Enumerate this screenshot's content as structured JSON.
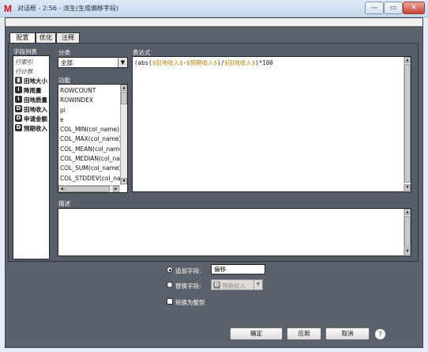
{
  "window": {
    "app_icon": "M",
    "title": "对话框 - 2:56 - 派生(生成偏移字段)",
    "minimize_glyph": "—",
    "maximize_glyph": "▭",
    "close_glyph": "✕"
  },
  "tabs": [
    {
      "label": "配置",
      "selected": true
    },
    {
      "label": "优化",
      "selected": false
    },
    {
      "label": "注释",
      "selected": false
    }
  ],
  "field_list": {
    "label": "字段列表",
    "items": [
      {
        "text": "行索引",
        "kind": "italic"
      },
      {
        "text": "行计数",
        "kind": "italic"
      },
      {
        "badge": "",
        "text": "田地大小",
        "icon": "ruler-icon"
      },
      {
        "badge": "i",
        "text": "降雨量"
      },
      {
        "badge": "i",
        "text": "田地质量"
      },
      {
        "badge": "D",
        "text": "田地收入"
      },
      {
        "badge": "D",
        "text": "申请金额"
      },
      {
        "badge": "D",
        "text": "预期收入"
      }
    ]
  },
  "category": {
    "label": "分类",
    "value": "全部"
  },
  "functions": {
    "label": "功能",
    "items": [
      "ROWCOUNT",
      "ROWINDEX",
      "pi",
      "e",
      "COL_MIN(col_name)",
      "COL_MAX(col_name)",
      "COL_MEAN(col_name)",
      "COL_MEDIAN(col_name)",
      "COL_SUM(col_name)",
      "COL_STDDEV(col_name)"
    ]
  },
  "expression": {
    "label": "表达式",
    "parts": [
      {
        "text": "(abs(",
        "color": "#1a1a1a"
      },
      {
        "text": "$田地收入$",
        "color": "#b8860b"
      },
      {
        "text": "-",
        "color": "#1a1a1a"
      },
      {
        "text": "$预期收入$",
        "color": "#b8860b"
      },
      {
        "text": ")/",
        "color": "#1a1a1a"
      },
      {
        "text": "$田地收入$",
        "color": "#b8860b"
      },
      {
        "text": ")*100",
        "color": "#1a1a1a"
      }
    ]
  },
  "description": {
    "label": "描述",
    "value": ""
  },
  "options": {
    "append_label": "追加字段:",
    "append_value": "偏移",
    "replace_label": "替换字段:",
    "replace_badge": "D",
    "replace_value": "预期收入",
    "convert_label": "转换为整型"
  },
  "buttons": {
    "ok": "确定",
    "apply": "应用",
    "cancel": "取消",
    "help": "?"
  },
  "colors": {
    "accent_field": "#b8860b",
    "panel_bg": "#575d66"
  }
}
